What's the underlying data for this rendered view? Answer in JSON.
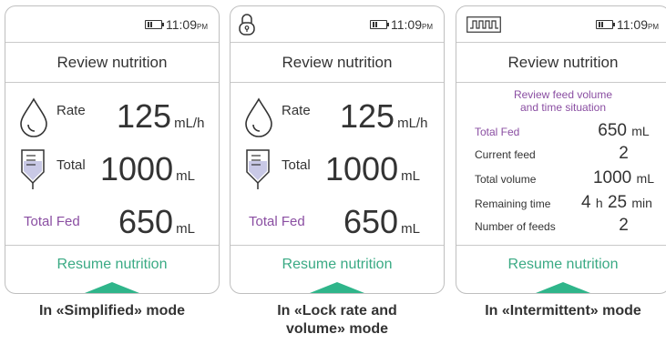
{
  "status": {
    "time": "11:09",
    "ampm": "PM"
  },
  "screens": [
    {
      "title": "Review nutrition",
      "rate_label": "Rate",
      "rate_value": "125",
      "rate_unit": "mL/h",
      "total_label": "Total",
      "total_value": "1000",
      "total_unit": "mL",
      "fed_label": "Total Fed",
      "fed_value": "650",
      "fed_unit": "mL",
      "resume": "Resume nutrition",
      "caption": "In «Simplified» mode"
    },
    {
      "title": "Review nutrition",
      "rate_label": "Rate",
      "rate_value": "125",
      "rate_unit": "mL/h",
      "total_label": "Total",
      "total_value": "1000",
      "total_unit": "mL",
      "fed_label": "Total Fed",
      "fed_value": "650",
      "fed_unit": "mL",
      "resume": "Resume nutrition",
      "caption_line1": "In «Lock rate and",
      "caption_line2": "volume» mode"
    },
    {
      "title": "Review nutrition",
      "subheading_line1": "Review feed volume",
      "subheading_line2": "and time situation",
      "rows": [
        {
          "label": "Total Fed",
          "value": "650",
          "unit": "mL"
        },
        {
          "label": "Current feed",
          "value": "2",
          "unit": ""
        },
        {
          "label": "Total volume",
          "value": "1000",
          "unit": "mL"
        },
        {
          "label": "Remaining time",
          "h": "4",
          "h_unit": "h",
          "min": "25",
          "min_unit": "min"
        },
        {
          "label": "Number of feeds",
          "value": "2",
          "unit": ""
        }
      ],
      "resume": "Resume nutrition",
      "caption": "In «Intermittent» mode"
    }
  ],
  "colors": {
    "accent_green": "#2fb58a",
    "resume_text": "#3aaa84",
    "purple": "#8a4ea2",
    "border": "#bfbfbf"
  }
}
